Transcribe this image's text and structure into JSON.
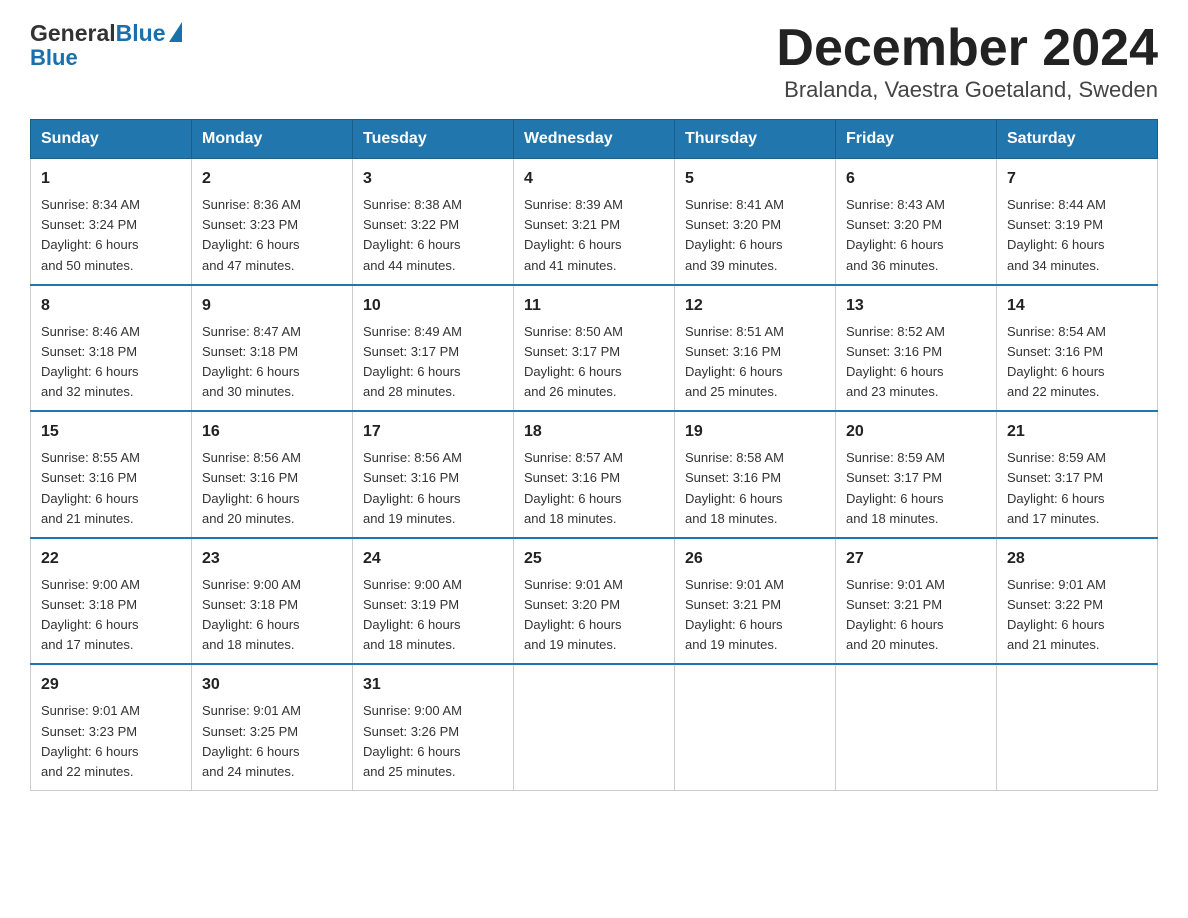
{
  "header": {
    "logo_general": "General",
    "logo_blue": "Blue",
    "title": "December 2024",
    "subtitle": "Bralanda, Vaestra Goetaland, Sweden"
  },
  "calendar": {
    "days": [
      "Sunday",
      "Monday",
      "Tuesday",
      "Wednesday",
      "Thursday",
      "Friday",
      "Saturday"
    ],
    "weeks": [
      [
        {
          "num": "1",
          "info": "Sunrise: 8:34 AM\nSunset: 3:24 PM\nDaylight: 6 hours\nand 50 minutes."
        },
        {
          "num": "2",
          "info": "Sunrise: 8:36 AM\nSunset: 3:23 PM\nDaylight: 6 hours\nand 47 minutes."
        },
        {
          "num": "3",
          "info": "Sunrise: 8:38 AM\nSunset: 3:22 PM\nDaylight: 6 hours\nand 44 minutes."
        },
        {
          "num": "4",
          "info": "Sunrise: 8:39 AM\nSunset: 3:21 PM\nDaylight: 6 hours\nand 41 minutes."
        },
        {
          "num": "5",
          "info": "Sunrise: 8:41 AM\nSunset: 3:20 PM\nDaylight: 6 hours\nand 39 minutes."
        },
        {
          "num": "6",
          "info": "Sunrise: 8:43 AM\nSunset: 3:20 PM\nDaylight: 6 hours\nand 36 minutes."
        },
        {
          "num": "7",
          "info": "Sunrise: 8:44 AM\nSunset: 3:19 PM\nDaylight: 6 hours\nand 34 minutes."
        }
      ],
      [
        {
          "num": "8",
          "info": "Sunrise: 8:46 AM\nSunset: 3:18 PM\nDaylight: 6 hours\nand 32 minutes."
        },
        {
          "num": "9",
          "info": "Sunrise: 8:47 AM\nSunset: 3:18 PM\nDaylight: 6 hours\nand 30 minutes."
        },
        {
          "num": "10",
          "info": "Sunrise: 8:49 AM\nSunset: 3:17 PM\nDaylight: 6 hours\nand 28 minutes."
        },
        {
          "num": "11",
          "info": "Sunrise: 8:50 AM\nSunset: 3:17 PM\nDaylight: 6 hours\nand 26 minutes."
        },
        {
          "num": "12",
          "info": "Sunrise: 8:51 AM\nSunset: 3:16 PM\nDaylight: 6 hours\nand 25 minutes."
        },
        {
          "num": "13",
          "info": "Sunrise: 8:52 AM\nSunset: 3:16 PM\nDaylight: 6 hours\nand 23 minutes."
        },
        {
          "num": "14",
          "info": "Sunrise: 8:54 AM\nSunset: 3:16 PM\nDaylight: 6 hours\nand 22 minutes."
        }
      ],
      [
        {
          "num": "15",
          "info": "Sunrise: 8:55 AM\nSunset: 3:16 PM\nDaylight: 6 hours\nand 21 minutes."
        },
        {
          "num": "16",
          "info": "Sunrise: 8:56 AM\nSunset: 3:16 PM\nDaylight: 6 hours\nand 20 minutes."
        },
        {
          "num": "17",
          "info": "Sunrise: 8:56 AM\nSunset: 3:16 PM\nDaylight: 6 hours\nand 19 minutes."
        },
        {
          "num": "18",
          "info": "Sunrise: 8:57 AM\nSunset: 3:16 PM\nDaylight: 6 hours\nand 18 minutes."
        },
        {
          "num": "19",
          "info": "Sunrise: 8:58 AM\nSunset: 3:16 PM\nDaylight: 6 hours\nand 18 minutes."
        },
        {
          "num": "20",
          "info": "Sunrise: 8:59 AM\nSunset: 3:17 PM\nDaylight: 6 hours\nand 18 minutes."
        },
        {
          "num": "21",
          "info": "Sunrise: 8:59 AM\nSunset: 3:17 PM\nDaylight: 6 hours\nand 17 minutes."
        }
      ],
      [
        {
          "num": "22",
          "info": "Sunrise: 9:00 AM\nSunset: 3:18 PM\nDaylight: 6 hours\nand 17 minutes."
        },
        {
          "num": "23",
          "info": "Sunrise: 9:00 AM\nSunset: 3:18 PM\nDaylight: 6 hours\nand 18 minutes."
        },
        {
          "num": "24",
          "info": "Sunrise: 9:00 AM\nSunset: 3:19 PM\nDaylight: 6 hours\nand 18 minutes."
        },
        {
          "num": "25",
          "info": "Sunrise: 9:01 AM\nSunset: 3:20 PM\nDaylight: 6 hours\nand 19 minutes."
        },
        {
          "num": "26",
          "info": "Sunrise: 9:01 AM\nSunset: 3:21 PM\nDaylight: 6 hours\nand 19 minutes."
        },
        {
          "num": "27",
          "info": "Sunrise: 9:01 AM\nSunset: 3:21 PM\nDaylight: 6 hours\nand 20 minutes."
        },
        {
          "num": "28",
          "info": "Sunrise: 9:01 AM\nSunset: 3:22 PM\nDaylight: 6 hours\nand 21 minutes."
        }
      ],
      [
        {
          "num": "29",
          "info": "Sunrise: 9:01 AM\nSunset: 3:23 PM\nDaylight: 6 hours\nand 22 minutes."
        },
        {
          "num": "30",
          "info": "Sunrise: 9:01 AM\nSunset: 3:25 PM\nDaylight: 6 hours\nand 24 minutes."
        },
        {
          "num": "31",
          "info": "Sunrise: 9:00 AM\nSunset: 3:26 PM\nDaylight: 6 hours\nand 25 minutes."
        },
        null,
        null,
        null,
        null
      ]
    ]
  }
}
